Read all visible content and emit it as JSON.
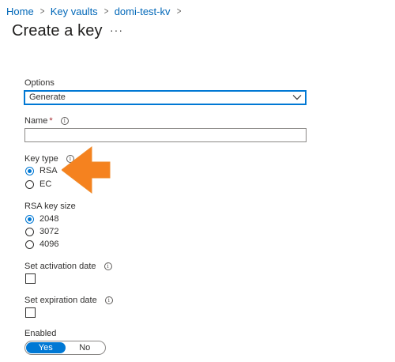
{
  "breadcrumb": {
    "items": [
      "Home",
      "Key vaults",
      "domi-test-kv"
    ]
  },
  "page": {
    "title": "Create a key",
    "more_label": "···"
  },
  "form": {
    "options": {
      "label": "Options",
      "selected": "Generate"
    },
    "name": {
      "label": "Name",
      "required_mark": "*",
      "value": ""
    },
    "key_type": {
      "label": "Key type",
      "options": [
        "RSA",
        "EC"
      ],
      "selected": "RSA"
    },
    "rsa_key_size": {
      "label": "RSA key size",
      "options": [
        "2048",
        "3072",
        "4096"
      ],
      "selected": "2048"
    },
    "activation_date": {
      "label": "Set activation date",
      "checked": false
    },
    "expiration_date": {
      "label": "Set expiration date",
      "checked": false
    },
    "enabled": {
      "label": "Enabled",
      "options": [
        "Yes",
        "No"
      ],
      "selected": "Yes"
    }
  },
  "info_icon_glyph": "i",
  "colors": {
    "accent": "#0078d4",
    "link": "#0067b8",
    "required": "#a4262c",
    "annotation_arrow": "#f5821f"
  },
  "annotation": {
    "icon": "orange-arrow-pointing-left"
  }
}
